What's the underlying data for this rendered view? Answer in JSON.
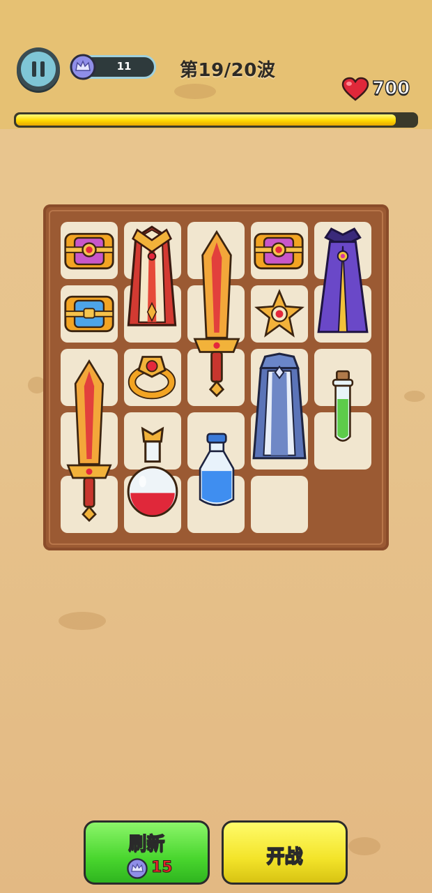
{
  "hud": {
    "gem_count": "11",
    "wave_text": "第19/20波",
    "health": "700",
    "wave_progress": 0.95
  },
  "buttons": {
    "refresh_label": "刷新",
    "refresh_cost": "15",
    "fight_label": "开战"
  },
  "board": {
    "items": [
      {
        "name": "treasure-chest-pink",
        "icon": "chest-pink"
      },
      {
        "name": "royal-robe",
        "icon": "robe-red-gold"
      },
      {
        "name": "golden-sword",
        "icon": "sword"
      },
      {
        "name": "treasure-chest-pink",
        "icon": "chest-pink"
      },
      {
        "name": "purple-cloak",
        "icon": "cloak-purple"
      },
      {
        "name": "treasure-chest-blue",
        "icon": "chest-blue"
      },
      {
        "name": "shuriken",
        "icon": "star-gold"
      },
      {
        "name": "golden-sword",
        "icon": "sword"
      },
      {
        "name": "golden-ring",
        "icon": "ring"
      },
      {
        "name": "blue-cloak",
        "icon": "cloak-blue"
      },
      {
        "name": "green-potion",
        "icon": "potion-green"
      },
      {
        "name": "red-potion",
        "icon": "potion-red"
      },
      {
        "name": "blue-potion",
        "icon": "potion-blue"
      }
    ]
  }
}
